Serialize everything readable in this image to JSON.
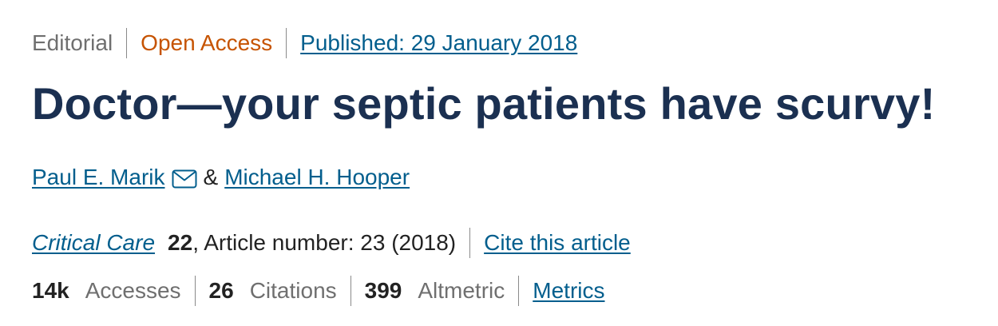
{
  "header": {
    "article_type": "Editorial",
    "access": "Open Access",
    "published": "Published: 29 January 2018"
  },
  "title": "Doctor—your septic patients have scurvy!",
  "authors": {
    "first": "Paul E. Marik",
    "separator": "&",
    "second": "Michael H. Hooper",
    "email_icon": "envelope-icon"
  },
  "citation": {
    "journal": "Critical Care",
    "volume": "22",
    "article_number": ", Article number: 23 (2018)",
    "cite_link": "Cite this article"
  },
  "metrics": {
    "accesses_value": "14k",
    "accesses_label": "Accesses",
    "citations_value": "26",
    "citations_label": "Citations",
    "altmetric_value": "399",
    "altmetric_label": "Altmetric",
    "metrics_link": "Metrics"
  },
  "colors": {
    "title": "#1b3051",
    "link": "#025e8d",
    "open_access": "#c65301",
    "muted": "#6f6f6f"
  }
}
